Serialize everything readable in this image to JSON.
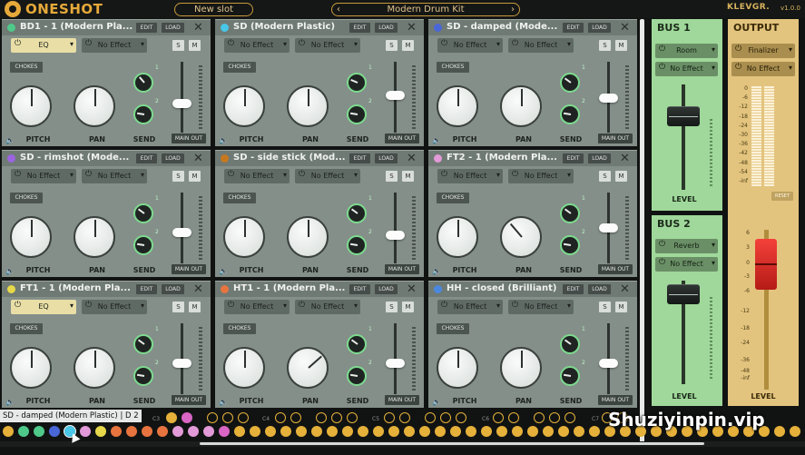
{
  "header": {
    "logo": "ONESHOT",
    "new_slot_label": "New slot",
    "kit_label": "Modern Drum Kit",
    "kit_prev": "‹",
    "kit_next": "›",
    "brand": "KLEVGR.",
    "version": "v1.0.0"
  },
  "slot_labels": {
    "edit": "EDIT",
    "load": "LOAD",
    "close": "✕",
    "solo": "S",
    "mute": "M",
    "chokes": "CHOKES",
    "pitch": "PITCH",
    "pan": "PAN",
    "send": "SEND",
    "main_out": "MAIN OUT",
    "send1": "1",
    "send2": "2",
    "power": "⏻",
    "caret": "▾",
    "speaker": "🔈"
  },
  "slots": [
    {
      "name": "BD1 - 1 (Modern Pla...",
      "color": "#4fc98a",
      "fx1": "EQ",
      "fx1_active": true,
      "fx2": "No Effect",
      "pitch": 0.5,
      "pan": 0.5,
      "send1": 0.35,
      "send2": 0.2,
      "fader": 0.42
    },
    {
      "name": "SD (Modern Plastic)",
      "color": "#48c7e8",
      "fx1": "No Effect",
      "fx1_active": false,
      "fx2": "No Effect",
      "pitch": 0.5,
      "pan": 0.5,
      "send1": 0.25,
      "send2": 0.2,
      "fader": 0.55
    },
    {
      "name": "SD - damped (Mode...",
      "color": "#4a67d8",
      "fx1": "No Effect",
      "fx1_active": false,
      "fx2": "No Effect",
      "pitch": 0.5,
      "pan": 0.5,
      "send1": 0.3,
      "send2": 0.2,
      "fader": 0.5
    },
    {
      "name": "SD - rimshot (Mode...",
      "color": "#9b63e0",
      "fx1": "No Effect",
      "fx1_active": false,
      "fx2": "No Effect",
      "pitch": 0.5,
      "pan": 0.5,
      "send1": 0.3,
      "send2": 0.2,
      "fader": 0.45
    },
    {
      "name": "SD - side stick (Mod...",
      "color": "#c7781f",
      "fx1": "No Effect",
      "fx1_active": false,
      "fx2": "No Effect",
      "pitch": 0.5,
      "pan": 0.5,
      "send1": 0.3,
      "send2": 0.2,
      "fader": 0.4
    },
    {
      "name": "FT2 - 1 (Modern Pla...",
      "color": "#e39ad8",
      "fx1": "No Effect",
      "fx1_active": false,
      "fx2": "No Effect",
      "pitch": 0.5,
      "pan": 0.35,
      "send1": 0.3,
      "send2": 0.2,
      "fader": 0.52
    },
    {
      "name": "FT1 - 1 (Modern Pla...",
      "color": "#e6d84a",
      "fx1": "EQ",
      "fx1_active": true,
      "fx2": "No Effect",
      "pitch": 0.5,
      "pan": 0.5,
      "send1": 0.3,
      "send2": 0.2,
      "fader": 0.45
    },
    {
      "name": "HT1 - 1 (Modern Pla...",
      "color": "#e7743f",
      "fx1": "No Effect",
      "fx1_active": false,
      "fx2": "No Effect",
      "pitch": 0.5,
      "pan": 0.68,
      "send1": 0.3,
      "send2": 0.2,
      "fader": 0.45
    },
    {
      "name": "HH - closed (Brilliant)",
      "color": "#4a88e0",
      "fx1": "No Effect",
      "fx1_active": false,
      "fx2": "No Effect",
      "pitch": 0.5,
      "pan": 0.5,
      "send1": 0.3,
      "send2": 0.2,
      "fader": 0.45
    }
  ],
  "bus1": {
    "title": "BUS 1",
    "fx1": "Room",
    "fx2": "No Effect",
    "level_label": "LEVEL",
    "level": 0.7
  },
  "bus2": {
    "title": "BUS 2",
    "fx1": "Reverb",
    "fx2": "No Effect",
    "level_label": "LEVEL",
    "level": 0.7
  },
  "output": {
    "title": "OUTPUT",
    "fx1": "Finalizer",
    "fx2": "No Effect",
    "meter_scale": [
      "0",
      "-6",
      "-12",
      "-18",
      "-24",
      "-30",
      "-36",
      "-42",
      "-48",
      "-54",
      "-inf"
    ],
    "reset_label": "RESET",
    "fader_scale": [
      "6",
      "3",
      "0",
      "-3",
      "-6",
      "-12",
      "-18",
      "-24",
      "-36",
      "-48",
      "-inf"
    ],
    "level_label": "LEVEL",
    "level_db": "0"
  },
  "keyboard": {
    "tooltip": "SD - damped (Modern Plastic) | D 2",
    "notes": [
      "C3",
      "C4",
      "C5",
      "C6",
      "C7"
    ],
    "row1_colors": [
      "",
      "",
      "",
      "",
      "",
      "",
      "",
      "",
      "",
      "",
      "",
      "",
      "",
      "",
      "#e6b13a",
      "#d965c4"
    ],
    "row2_colors": [
      "#e6b13a",
      "#4fc98a",
      "#4fc98a",
      "#4a67d8",
      "#48c7e8",
      "#e39ad8",
      "#e6d84a",
      "#e7743f",
      "#e7743f",
      "#e7743f",
      "#e7743f",
      "#e39ad8",
      "#e39ad8",
      "#e39ad8",
      "#d965c4"
    ]
  },
  "watermark": "Shuziyinpin.vip"
}
